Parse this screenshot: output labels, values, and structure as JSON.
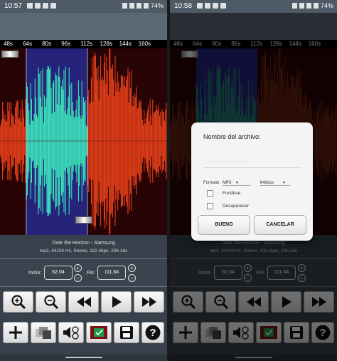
{
  "status_left": {
    "time": "10:57",
    "battery": "74%"
  },
  "status_right": {
    "time": "10:58",
    "battery": "74%"
  },
  "timeline": [
    "48s",
    "64s",
    "80s",
    "96s",
    "112s",
    "128s",
    "144s",
    "160s"
  ],
  "track": {
    "title": "Over the Horizon - Samsung",
    "details": "mp3, 44100 Hz, Stereo, 192 kbps, 206.16s"
  },
  "controls": {
    "start_label": "Inicio:",
    "start_value": "62.04",
    "end_label": "Fin:",
    "end_value": "111.64"
  },
  "toolbar_row1": [
    "zoom-in-icon",
    "zoom-out-icon",
    "rewind-icon",
    "play-icon",
    "fast-forward-icon"
  ],
  "toolbar_row2": [
    "add-icon",
    "fade-icon",
    "volume-icon",
    "contacts-icon",
    "save-icon",
    "help-icon"
  ],
  "dialog": {
    "title": "Nombre del archivo:",
    "filename_placeholder": "Overtheorizon_cut",
    "format_label": "Formato",
    "format_value": "MP3",
    "bitrate_value": "64kbps",
    "fade_in_label": "Fundirse",
    "fade_out_label": "Desaparecer",
    "ok_label": "BUENO",
    "cancel_label": "CANCELAR"
  },
  "colors": {
    "selection_wave": "#3ef2c0",
    "outer_wave": "#f0441a",
    "selection_bg": "#25237a",
    "background": "#290407"
  }
}
